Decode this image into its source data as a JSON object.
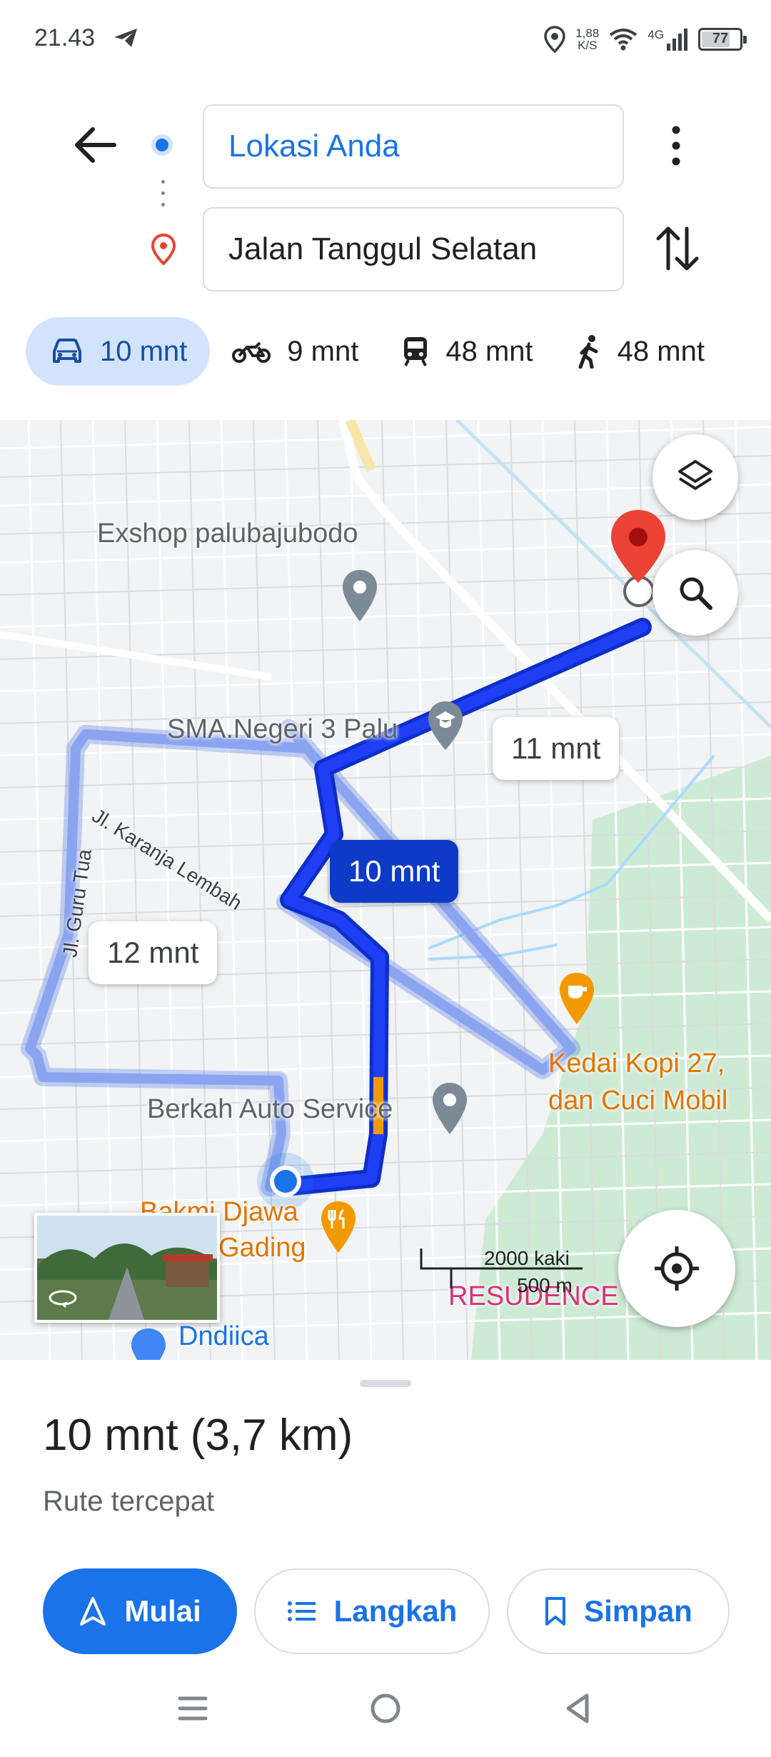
{
  "status_bar": {
    "time": "21.43",
    "net_speed_value": "1,88",
    "net_speed_unit": "K/S",
    "network_type": "4G",
    "battery": "77",
    "battery_level": 0.77
  },
  "directions": {
    "origin": "Lokasi Anda",
    "destination": "Jalan Tanggul Selatan"
  },
  "modes": [
    {
      "icon": "car-icon",
      "label": "10 mnt",
      "active": true
    },
    {
      "icon": "motorcycle-icon",
      "label": "9 mnt",
      "active": false
    },
    {
      "icon": "transit-icon",
      "label": "48 mnt",
      "active": false
    },
    {
      "icon": "walk-icon",
      "label": "48 mnt",
      "active": false
    }
  ],
  "map": {
    "labels": {
      "exshop": "Exshop palubajubodo",
      "sma": "SMA.Negeri 3 Palu",
      "karanja": "Jl. Karanja Lembah",
      "guru_tua": "Jl. Guru Tua",
      "berkah": "Berkah Auto Service",
      "kedai_line1": "Kedai Kopi 27,",
      "kedai_line2": "dan Cuci Mobil",
      "bakmi_line1": "Bakmi Djawa",
      "bakmi_line2": "Gading",
      "dndiica": "Dndiica",
      "resudence": "RESUDENCE"
    },
    "route_times": {
      "primary": "10 mnt",
      "alt_1": "11 mnt",
      "alt_2": "12 mnt"
    },
    "scale": {
      "feet": "2000 kaki",
      "meters": "500 m"
    },
    "colors": {
      "primary_route": "#1f3ff5",
      "alt_route": "#8aa4f0",
      "traffic_slow": "#f29900",
      "destination_pin": "#ea4335"
    }
  },
  "route_summary": {
    "title": "10 mnt (3,7 km)",
    "subtitle": "Rute tercepat"
  },
  "actions": {
    "start": "Mulai",
    "steps": "Langkah",
    "save": "Simpan"
  }
}
